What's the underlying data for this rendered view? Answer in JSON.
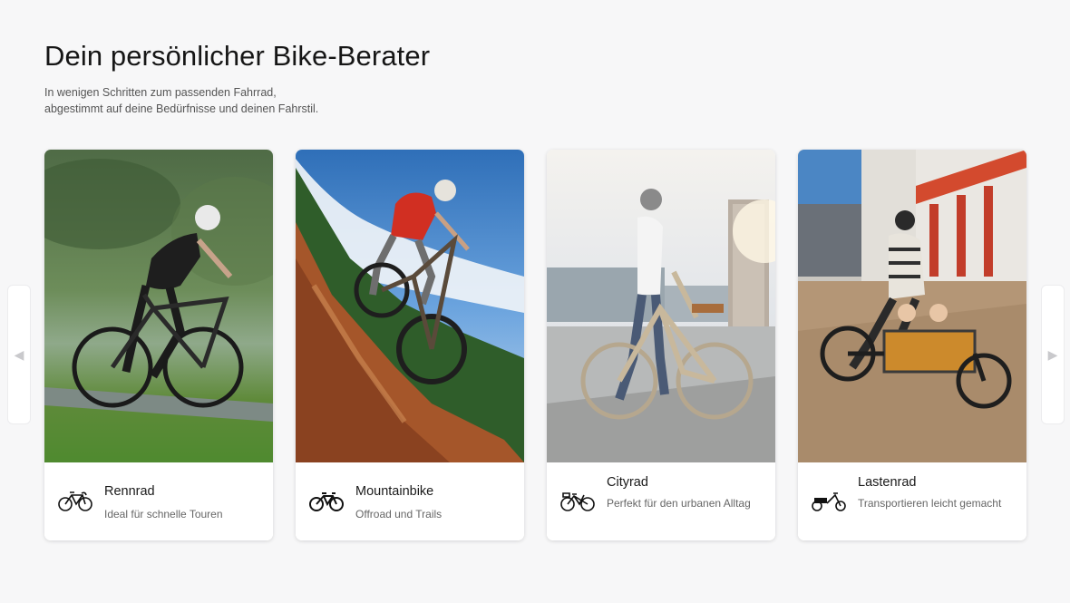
{
  "header": {
    "title": "Dein persönlicher Bike-Berater",
    "subtitle_line1": "In wenigen Schritten zum passenden Fahrrad,",
    "subtitle_line2": "abgestimmt auf deine Bedürfnisse und deinen Fahrstil."
  },
  "carousel": {
    "prev_icon": "◀",
    "next_icon": "▶",
    "cards": [
      {
        "name": "Rennrad",
        "desc": "Ideal für schnelle Touren",
        "icon": "road-bike-icon"
      },
      {
        "name": "Mountainbike",
        "desc": "Offroad und Trails",
        "icon": "mountain-bike-icon"
      },
      {
        "name": "Cityrad",
        "desc": "Perfekt für den urbanen Alltag",
        "icon": "city-bike-icon"
      },
      {
        "name": "Lastenrad",
        "desc": "Transportieren leicht gemacht",
        "icon": "cargo-bike-icon"
      }
    ]
  }
}
